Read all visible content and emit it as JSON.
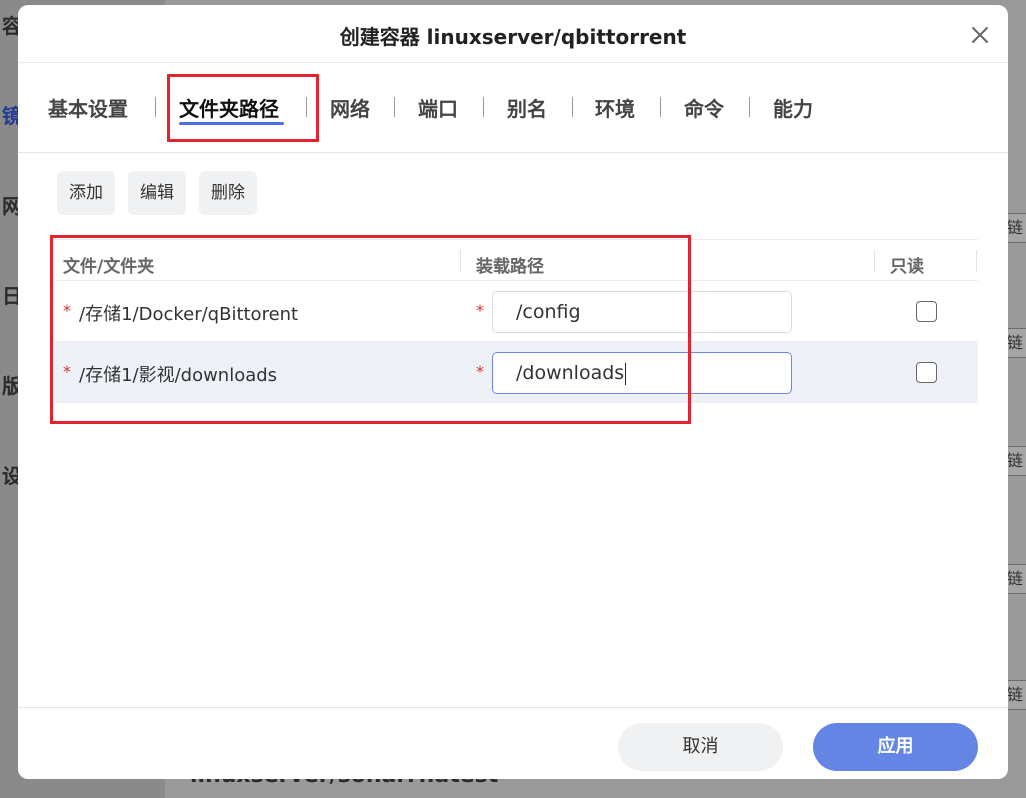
{
  "background": {
    "sidebar_items": [
      "容器",
      "镜",
      "网",
      "日",
      "版本",
      "设"
    ],
    "right_buttons": [
      "链接",
      "链接",
      "链接",
      "链接",
      "链接"
    ],
    "bottom_text": "linuxserver/sonarr:latest"
  },
  "dialog": {
    "title": "创建容器 linuxserver/qbittorrent",
    "tabs": [
      "基本设置",
      "文件夹路径",
      "网络",
      "端口",
      "别名",
      "环境",
      "命令",
      "能力"
    ],
    "active_tab": "文件夹路径",
    "toolbar": {
      "add": "添加",
      "edit": "编辑",
      "delete": "删除"
    },
    "table": {
      "headers": {
        "file": "文件/文件夹",
        "mount": "装载路径",
        "readonly": "只读"
      },
      "rows": [
        {
          "path": "/存储1/Docker/qBittorent",
          "mount": "/config",
          "readonly": false
        },
        {
          "path": "/存储1/影视/downloads",
          "mount": "/downloads",
          "readonly": false
        }
      ]
    },
    "footer": {
      "cancel": "取消",
      "apply": "应用"
    }
  },
  "colors": {
    "accent": "#6485e3",
    "highlight_box": "#e5232e",
    "required": "#d4332a"
  }
}
